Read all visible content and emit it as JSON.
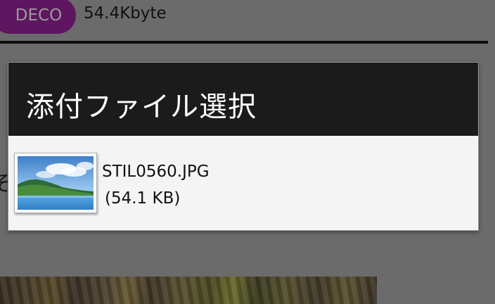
{
  "background": {
    "deco_badge": "DECO",
    "message_size": "54.4Kbyte",
    "partial_char": "そ"
  },
  "dialog": {
    "title": "添付ファイル選択",
    "files": [
      {
        "name": "STIL0560.JPG",
        "size": "(54.1 KB)",
        "icon": "image-file-icon"
      }
    ]
  },
  "colors": {
    "dim_background": "#6b6b6b",
    "title_bar": "#1b1b1b",
    "dialog_body": "#f4f4f4",
    "deco_badge": "#5e1660"
  }
}
